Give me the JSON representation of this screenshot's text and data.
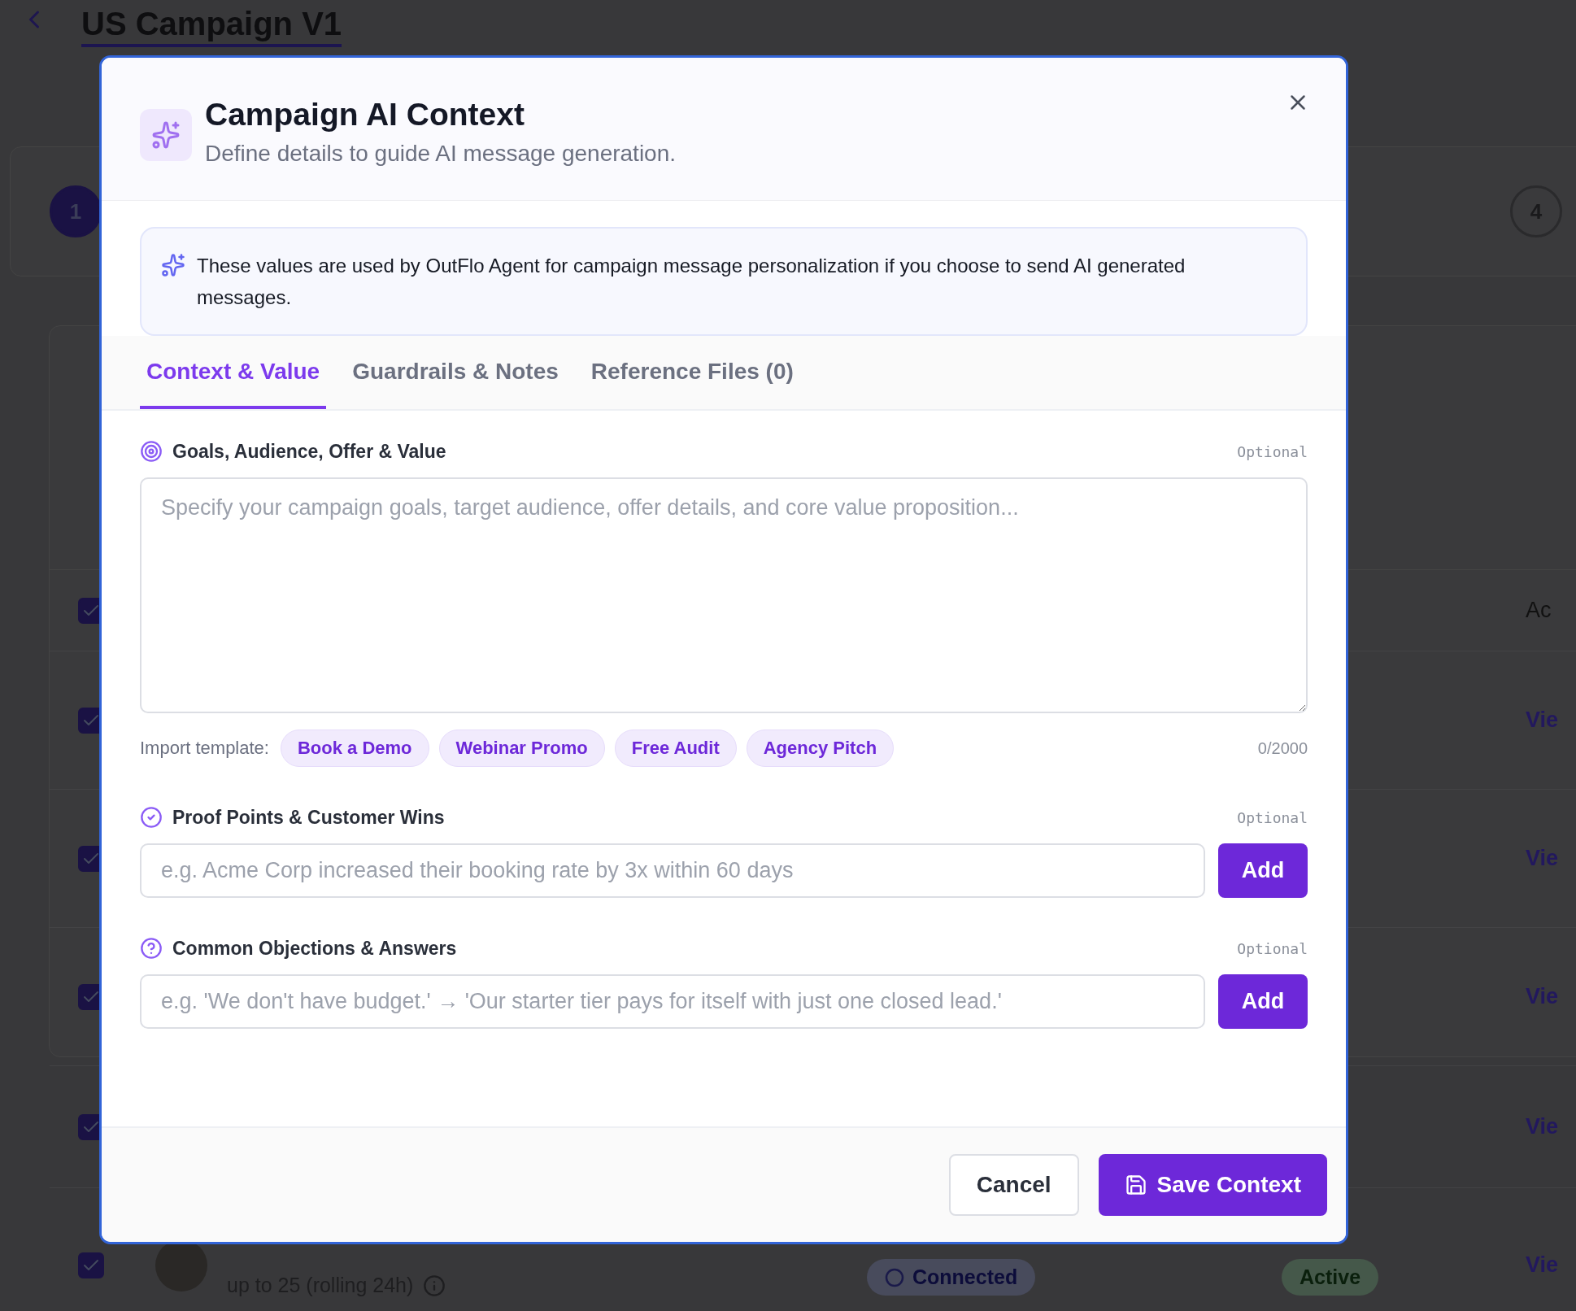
{
  "page": {
    "title": "US Campaign V1",
    "steps": [
      {
        "label": "1",
        "selected": true
      },
      {
        "label": "4",
        "selected": false
      }
    ],
    "table": {
      "header": {
        "checked": true,
        "label": "Ac"
      },
      "rows": [
        {
          "checked": true,
          "link": "Vie"
        },
        {
          "checked": true,
          "link": "Vie"
        },
        {
          "checked": true,
          "link": "Vie"
        },
        {
          "checked": true,
          "link": "Vie"
        },
        {
          "checked": true,
          "link": "Vie",
          "subtitle": "up to 25 (rolling 24h)",
          "connection": "Connected",
          "status": "Active"
        }
      ]
    }
  },
  "dialog": {
    "title": "Campaign AI Context",
    "subtitle": "Define details to guide AI message generation.",
    "notice": "These values are used by OutFlo Agent for campaign message personalization if you choose to send AI generated messages.",
    "tabs": [
      {
        "label": "Context & Value",
        "selected": true
      },
      {
        "label": "Guardrails & Notes",
        "selected": false
      },
      {
        "label": "Reference Files (0)",
        "selected": false
      }
    ],
    "sections": [
      {
        "kind": "textarea",
        "label": "Goals, Audience, Offer & Value",
        "optional": "Optional",
        "placeholder": "Specify your campaign goals, target audience, offer details, and core value proposition...",
        "templates_label": "Import template:",
        "templates": [
          "Book a Demo",
          "Webinar Promo",
          "Free Audit",
          "Agency Pitch"
        ],
        "counter": "0/2000"
      },
      {
        "kind": "input",
        "label": "Proof Points & Customer Wins",
        "optional": "Optional",
        "placeholder": "e.g. Acme Corp increased their booking rate by 3x within 60 days",
        "button": "Add"
      },
      {
        "kind": "input",
        "label": "Common Objections & Answers",
        "optional": "Optional",
        "placeholder": "e.g. 'We don't have budget.' → 'Our starter tier pays for itself with just one closed lead.'",
        "button": "Add"
      }
    ],
    "buttons": [
      {
        "kind": "secondary",
        "label": "Cancel"
      },
      {
        "kind": "primary",
        "label": "Save Context"
      }
    ]
  }
}
